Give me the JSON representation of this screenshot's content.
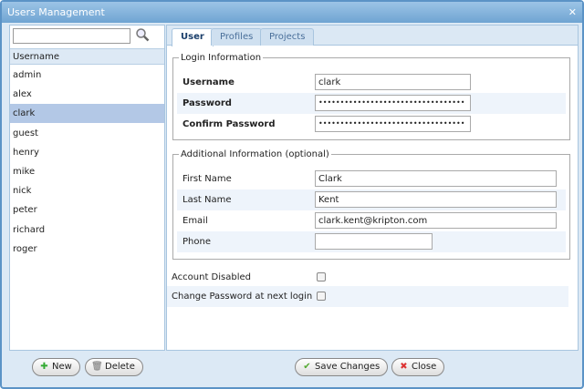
{
  "window": {
    "title": "Users Management"
  },
  "search": {
    "placeholder": "",
    "value": ""
  },
  "list": {
    "header": "Username",
    "items": [
      "admin",
      "alex",
      "clark",
      "guest",
      "henry",
      "mike",
      "nick",
      "peter",
      "richard",
      "roger"
    ],
    "selected": "clark"
  },
  "tabs": [
    "User",
    "Profiles",
    "Projects"
  ],
  "login": {
    "legend": "Login Information",
    "username_label": "Username",
    "username": "clark",
    "password_label": "Password",
    "password": "••••••••••••••••••••••••••••••••••",
    "confirm_label": "Confirm Password",
    "confirm": "••••••••••••••••••••••••••••••••••"
  },
  "additional": {
    "legend": "Additional Information (optional)",
    "first_label": "First Name",
    "first": "Clark",
    "last_label": "Last Name",
    "last": "Kent",
    "email_label": "Email",
    "email": "clark.kent@kripton.com",
    "phone_label": "Phone",
    "phone": ""
  },
  "options": {
    "disabled_label": "Account Disabled",
    "disabled": false,
    "change_pw_label": "Change Password at next login",
    "change_pw": false
  },
  "buttons": {
    "new": "New",
    "delete": "Delete",
    "save": "Save Changes",
    "close": "Close"
  }
}
